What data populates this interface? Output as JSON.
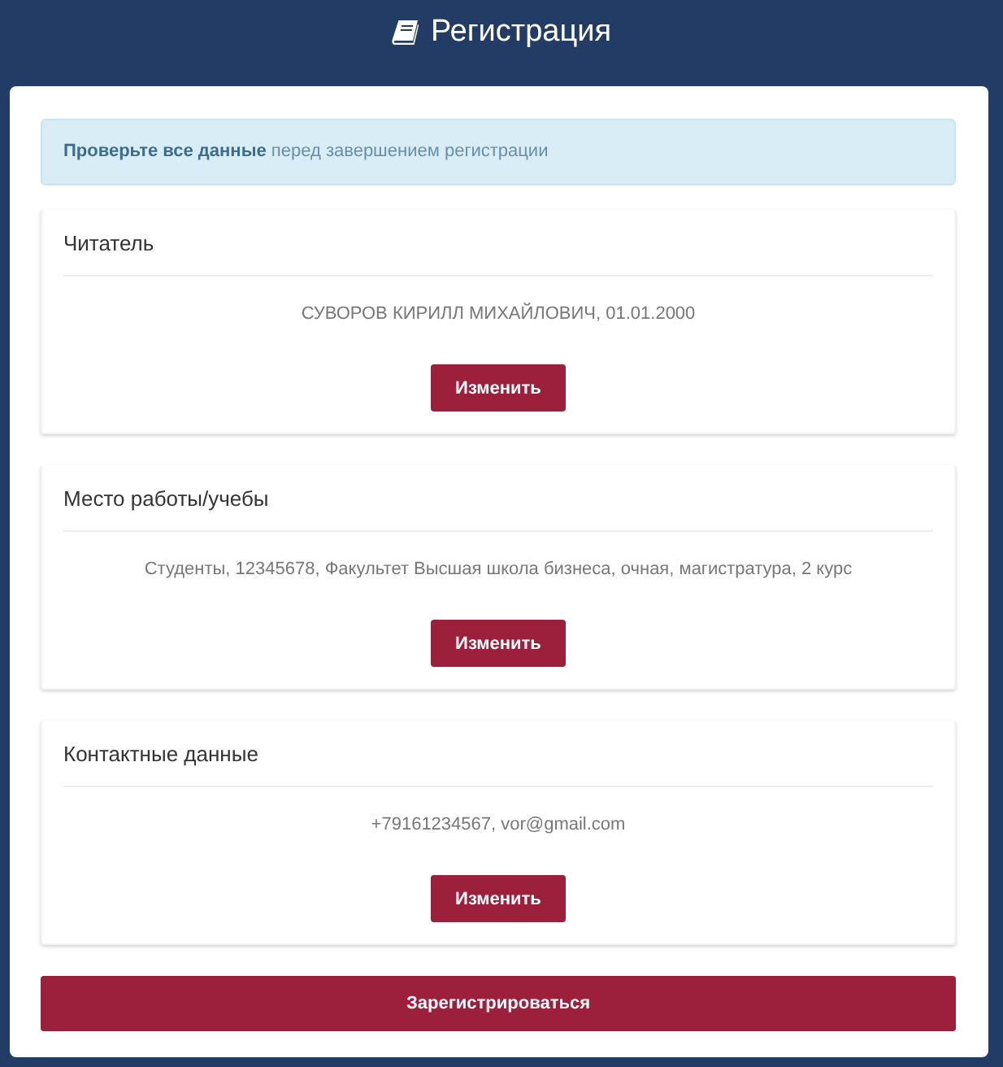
{
  "header": {
    "title": "Регистрация"
  },
  "alert": {
    "text": "**Проверьте все данные** перед завершением регистрации"
  },
  "sections": [
    {
      "title": "Читатель",
      "value": "СУВОРОВ КИРИЛЛ МИХАЙЛОВИЧ, 01.01.2000",
      "button": "Изменить"
    },
    {
      "title": "Место работы/учебы",
      "value": "Студенты, 12345678, Факультет Высшая школа бизнеса, очная, магистратура, 2 курс",
      "button": "Изменить"
    },
    {
      "title": "Контактные данные",
      "value": "+79161234567, vor@gmail.com",
      "button": "Изменить"
    }
  ],
  "submit_button": "Зарегистрироваться"
}
